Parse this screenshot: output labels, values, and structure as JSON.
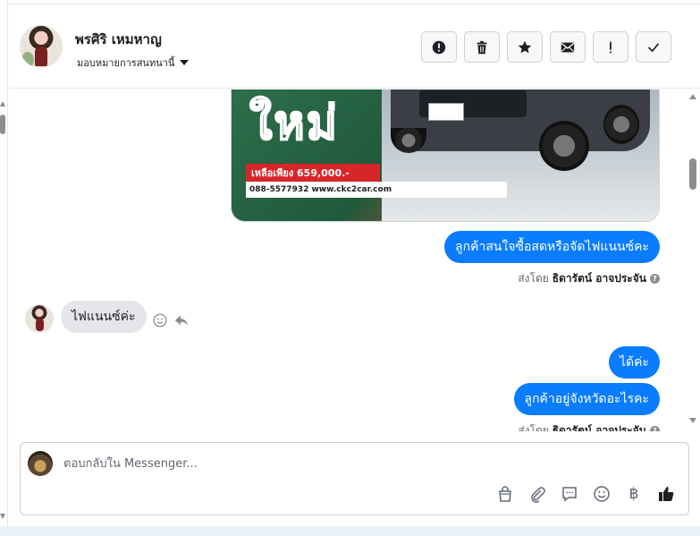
{
  "header": {
    "contact_name": "พรศิริ เหมหาญ",
    "assign_label": "มอบหมายการสนทนานี้",
    "actions": [
      {
        "name": "spam-button",
        "icon": "alert-circle-icon"
      },
      {
        "name": "delete-button",
        "icon": "trash-icon"
      },
      {
        "name": "star-button",
        "icon": "star-icon"
      },
      {
        "name": "mark-unread-button",
        "icon": "envelope-icon"
      },
      {
        "name": "follow-up-button",
        "icon": "exclamation-icon"
      },
      {
        "name": "mark-done-button",
        "icon": "check-icon"
      }
    ]
  },
  "ad": {
    "headline": "ใหม่",
    "price": "เหลือเพียง 659,000.-",
    "contact": "088-5577932 www.ckc2car.com"
  },
  "messages": [
    {
      "direction": "out",
      "text": "ลูกค้าสนใจซื้อสดหรือจัดไฟแนนซ์คะ"
    },
    {
      "direction": "in",
      "text": "ไฟแนนซ์ค่ะ"
    },
    {
      "direction": "out",
      "text": "ได้ค่ะ"
    },
    {
      "direction": "out",
      "text": "ลูกค้าอยู่จังหวัดอะไรคะ"
    }
  ],
  "sent_by": {
    "prefix": "ส่งโดย",
    "agent": "ธิดารัตน์ อาจประจัน"
  },
  "composer": {
    "placeholder": "ตอบกลับใน Messenger...",
    "currency_symbol": "฿"
  },
  "colors": {
    "outgoing_bubble": "#0a7cff",
    "incoming_bubble": "#e4e6eb",
    "muted_icon": "#606770"
  }
}
